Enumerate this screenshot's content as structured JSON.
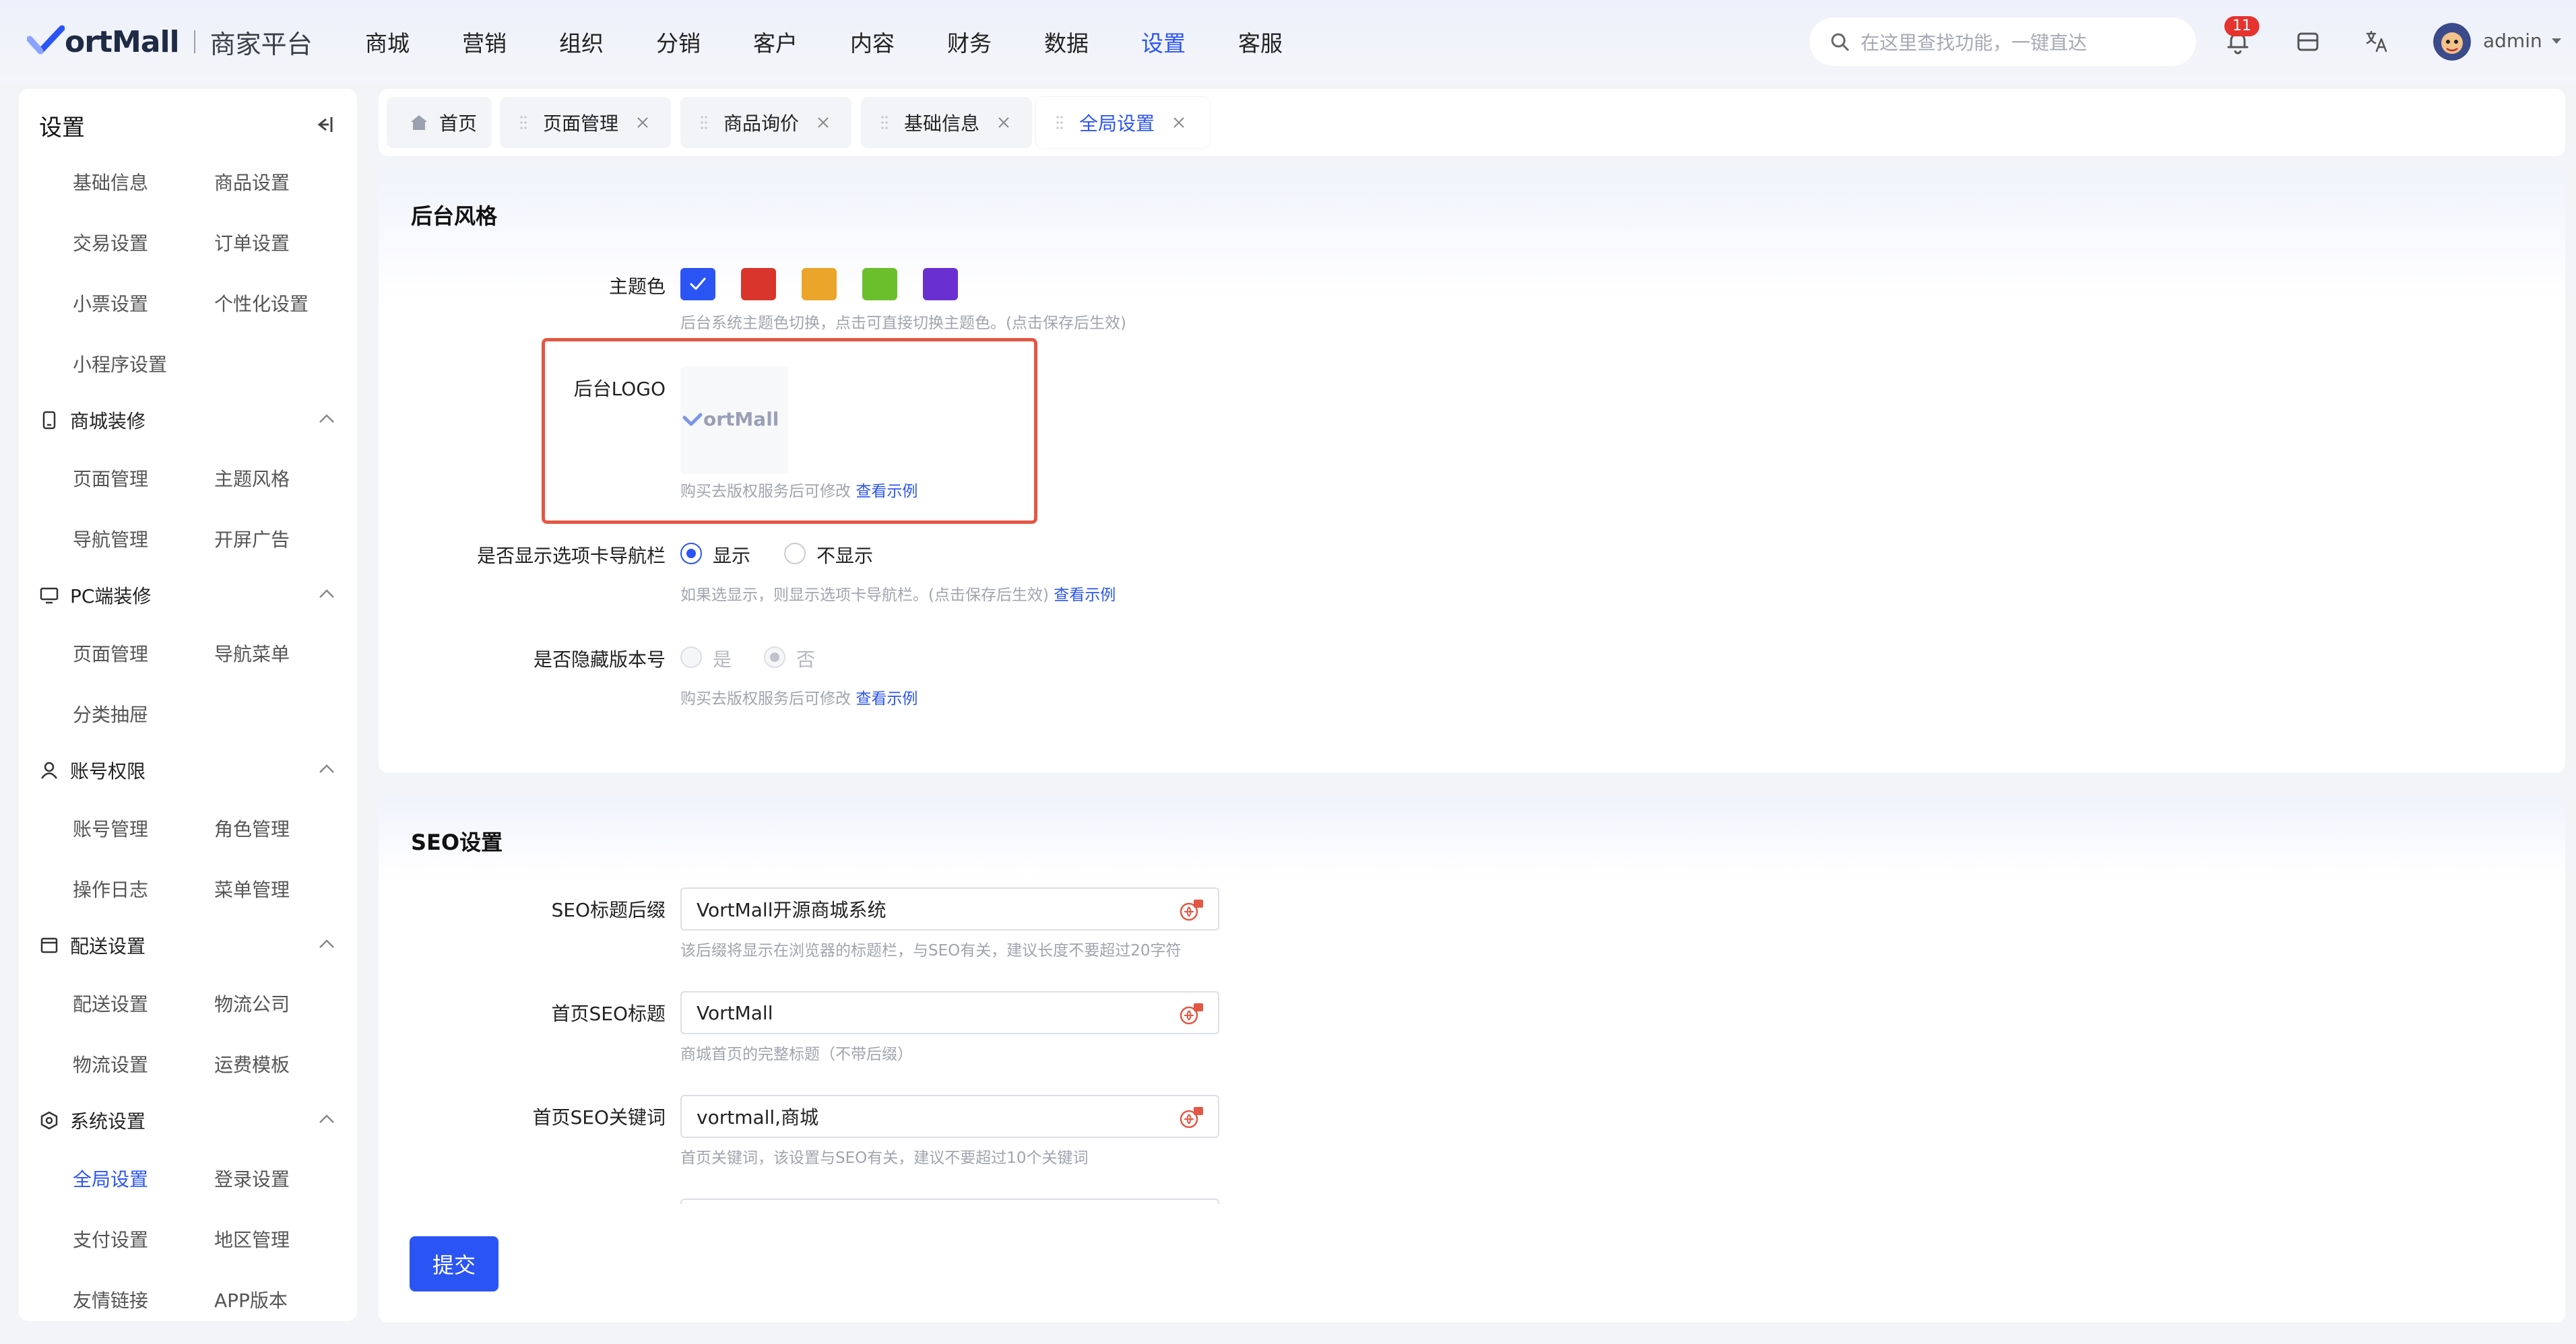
{
  "app": {
    "logo_text": "ortMall",
    "subtitle": "商家平台"
  },
  "nav": [
    "商城",
    "营销",
    "组织",
    "分销",
    "客户",
    "内容",
    "财务",
    "数据",
    "设置",
    "客服"
  ],
  "nav_active": "设置",
  "search": {
    "placeholder": "在这里查找功能，一键直达"
  },
  "notifications": {
    "count": "11"
  },
  "user": {
    "name": "admin"
  },
  "sidebar": {
    "title": "设置",
    "top_links": [
      "基础信息",
      "商品设置",
      "交易设置",
      "订单设置",
      "小票设置",
      "个性化设置",
      "小程序设置"
    ],
    "groups": [
      {
        "label": "商城装修",
        "icon": "phone-icon",
        "links": [
          "页面管理",
          "主题风格",
          "导航管理",
          "开屏广告"
        ]
      },
      {
        "label": "PC端装修",
        "icon": "monitor-icon",
        "links": [
          "页面管理",
          "导航菜单",
          "分类抽屉"
        ]
      },
      {
        "label": "账号权限",
        "icon": "user-icon",
        "links": [
          "账号管理",
          "角色管理",
          "操作日志",
          "菜单管理"
        ]
      },
      {
        "label": "配送设置",
        "icon": "delivery-icon",
        "links": [
          "配送设置",
          "物流公司",
          "物流设置",
          "运费模板"
        ]
      },
      {
        "label": "系统设置",
        "icon": "system-icon",
        "links": [
          "全局设置",
          "登录设置",
          "支付设置",
          "地区管理",
          "友情链接",
          "APP版本"
        ]
      }
    ],
    "active_link": "全局设置"
  },
  "tabs": [
    {
      "label": "首页",
      "closable": false
    },
    {
      "label": "页面管理",
      "closable": true
    },
    {
      "label": "商品询价",
      "closable": true
    },
    {
      "label": "基础信息",
      "closable": true
    },
    {
      "label": "全局设置",
      "closable": true
    }
  ],
  "active_tab": "全局设置",
  "style_section": {
    "title": "后台风格",
    "theme_color": {
      "label": "主题色",
      "colors": [
        "#2b54f4",
        "#d9352c",
        "#eba52a",
        "#6bbf2c",
        "#6a2fd0"
      ],
      "selected_index": 0,
      "hint": "后台系统主题色切换，点击可直接切换主题色。(点击保存后生效)"
    },
    "logo": {
      "label": "后台LOGO",
      "logo_text": "ortMall",
      "hint": "购买去版权服务后可修改",
      "hint_link": "查看示例"
    },
    "tab_nav": {
      "label": "是否显示选项卡导航栏",
      "options": [
        "显示",
        "不显示"
      ],
      "selected": "显示",
      "hint": "如果选显示，则显示选项卡导航栏。(点击保存后生效)",
      "hint_link": "查看示例"
    },
    "hide_version": {
      "label": "是否隐藏版本号",
      "options": [
        "是",
        "否"
      ],
      "selected": "否",
      "disabled": true,
      "hint": "购买去版权服务后可修改",
      "hint_link": "查看示例"
    }
  },
  "seo_section": {
    "title": "SEO设置",
    "fields": [
      {
        "label": "SEO标题后缀",
        "value": "VortMall开源商城系统",
        "hint": "该后缀将显示在浏览器的标题栏，与SEO有关，建议长度不要超过20字符"
      },
      {
        "label": "首页SEO标题",
        "value": "VortMall",
        "hint": "商城首页的完整标题（不带后缀）"
      },
      {
        "label": "首页SEO关键词",
        "value": "vortmall,商城",
        "hint": "首页关键词，该设置与SEO有关，建议不要超过10个关键词"
      }
    ]
  },
  "submit_label": "提交",
  "colors": {
    "accent": "#2b54f4",
    "highlight_border": "#e35744",
    "badge": "#e5342f"
  }
}
